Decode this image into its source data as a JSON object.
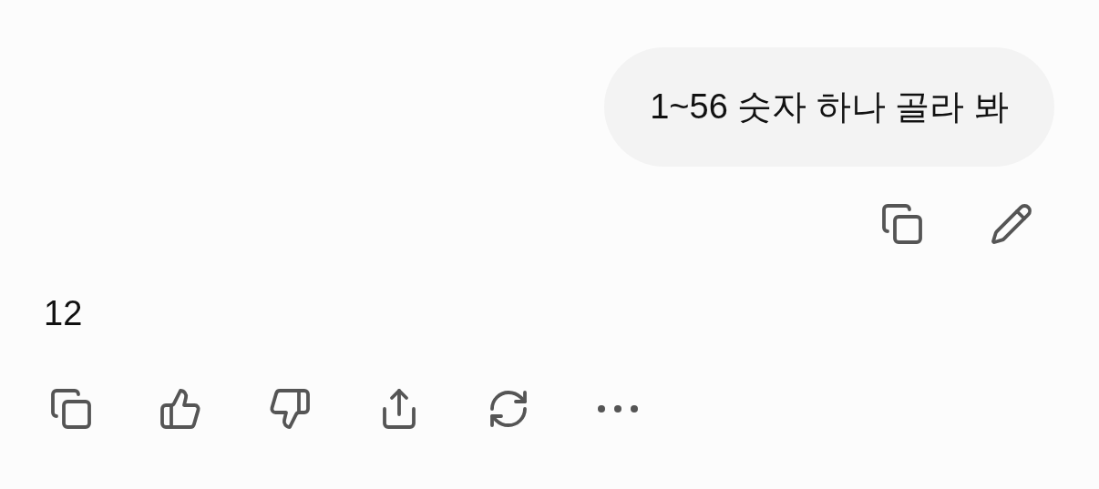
{
  "user_message": {
    "text": "1~56 숫자 하나 골라 봐"
  },
  "assistant_message": {
    "text": "12"
  }
}
